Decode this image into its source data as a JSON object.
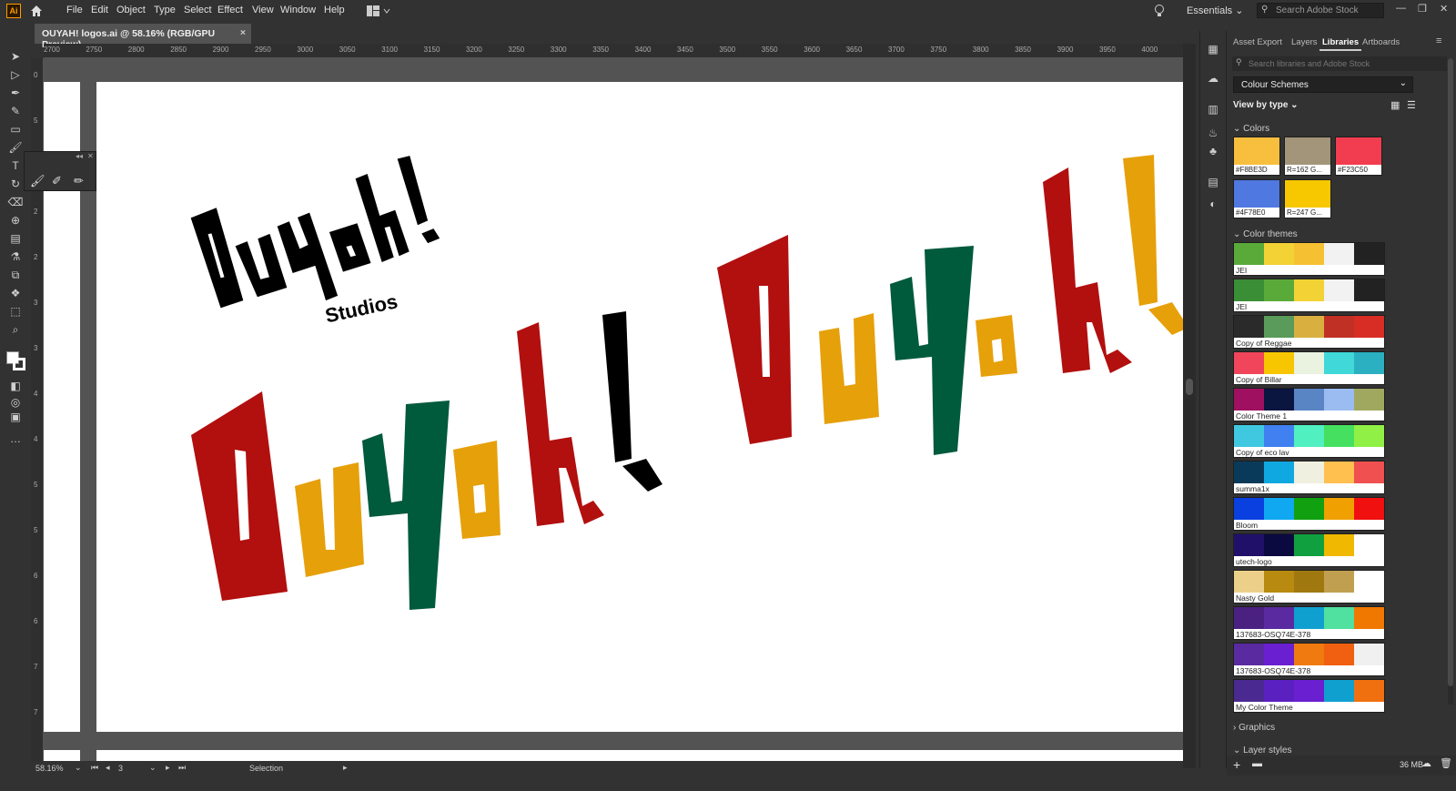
{
  "menubar": {
    "app_logo": "Ai",
    "items": [
      "File",
      "Edit",
      "Object",
      "Type",
      "Select",
      "Effect",
      "View",
      "Window",
      "Help"
    ],
    "workspace": "Essentials",
    "search_placeholder": "Search Adobe Stock"
  },
  "document": {
    "tab_title": "OUYAH! logos.ai @ 58.16% (RGB/GPU Preview)",
    "close": "×"
  },
  "rulers": {
    "top": [
      "2700",
      "2750",
      "2800",
      "2850",
      "2900",
      "2950",
      "3000",
      "3050",
      "3100",
      "3150",
      "3200",
      "3250",
      "3300",
      "3350",
      "3400",
      "3450",
      "3500",
      "3550",
      "3600",
      "3650",
      "3700",
      "3750",
      "3800",
      "3850",
      "3900",
      "3950",
      "4000"
    ],
    "left": [
      "0",
      "5",
      "1",
      "2",
      "2",
      "3",
      "3",
      "4",
      "4",
      "5",
      "5",
      "6",
      "6",
      "7",
      "7"
    ]
  },
  "artwork": {
    "logo_black": "Ouyah!",
    "logo_sub": "Studios",
    "logo_red": [
      "O",
      "u",
      "y",
      "a",
      "h",
      "!"
    ],
    "logo_yellow": [
      "O",
      "u",
      "y",
      "a",
      "h",
      "!"
    ]
  },
  "status": {
    "zoom": "58.16%",
    "artboard": "3",
    "tool": "Selection"
  },
  "panel": {
    "tabs": [
      "Asset Export",
      "Layers",
      "Libraries",
      "Artboards"
    ],
    "active_tab": "Libraries",
    "search_placeholder": "Search libraries and Adobe Stock",
    "library": "Colour Schemes",
    "view_by": "View by type",
    "colors_header": "Colors",
    "colors": [
      {
        "label": "#F8BE3D",
        "hex": "#F8BE3D"
      },
      {
        "label": "R=162 G...",
        "hex": "#A2957A"
      },
      {
        "label": "#F23C50",
        "hex": "#F23C50"
      },
      {
        "label": "#4F78E0",
        "hex": "#4F78E0"
      },
      {
        "label": "R=247 G...",
        "hex": "#F7C800"
      }
    ],
    "themes_header": "Color themes",
    "themes": [
      {
        "name": "JEI",
        "colors": [
          "#5aaa3a",
          "#f2d234",
          "#f5c032",
          "#f2f2f2",
          "#222222"
        ]
      },
      {
        "name": "JEI",
        "colors": [
          "#3a8e35",
          "#5aaa3a",
          "#f2d234",
          "#f2f2f2",
          "#222222"
        ]
      },
      {
        "name": "Copy of Reggae",
        "colors": [
          "#2a2a2a",
          "#5a9a5a",
          "#d9b040",
          "#c03025",
          "#d82d25"
        ]
      },
      {
        "name": "Copy of Billar",
        "colors": [
          "#f0455a",
          "#f7c600",
          "#eaf2e0",
          "#40d8d8",
          "#2ab0c0"
        ]
      },
      {
        "name": "Color Theme 1",
        "colors": [
          "#a01060",
          "#0a1540",
          "#5a85c5",
          "#9abcf0",
          "#a0a860"
        ]
      },
      {
        "name": "Copy of eco lav",
        "colors": [
          "#40c8e0",
          "#4080f0",
          "#50f0c0",
          "#45e060",
          "#90f045"
        ]
      },
      {
        "name": "summa1x",
        "colors": [
          "#0a3a5a",
          "#10a8e0",
          "#f0f0e0",
          "#ffc050",
          "#f05050"
        ]
      },
      {
        "name": "Bloom",
        "colors": [
          "#0a40e0",
          "#10a8f0",
          "#10a010",
          "#f0a000",
          "#f01010"
        ]
      },
      {
        "name": "utech-logo",
        "colors": [
          "#20106a",
          "#0a0a40",
          "#10a040",
          "#f0b800",
          "#ffffff"
        ]
      },
      {
        "name": "Nasty Gold",
        "colors": [
          "#ecd08a",
          "#b88a10",
          "#a07810",
          "#c0a050",
          "#ffffff"
        ]
      },
      {
        "name": "137683-OSQ74E-378",
        "colors": [
          "#4a2080",
          "#5a2aa0",
          "#10a0d0",
          "#50e0a0",
          "#f07800"
        ]
      },
      {
        "name": "137683-OSQ74E-378",
        "colors": [
          "#5a2aa0",
          "#6a20d0",
          "#f07a10",
          "#f06010",
          "#f0f0f0"
        ]
      },
      {
        "name": "My Color Theme",
        "colors": [
          "#4a2a90",
          "#5a20c0",
          "#6a20d0",
          "#10a0d0",
          "#f07010"
        ]
      }
    ],
    "graphics_header": "Graphics",
    "layerstyles_header": "Layer styles",
    "storage": "36 MB"
  },
  "colors": {
    "red": "#b20f0f",
    "yellow": "#e6a00a",
    "green": "#005a3c",
    "black": "#000000"
  }
}
